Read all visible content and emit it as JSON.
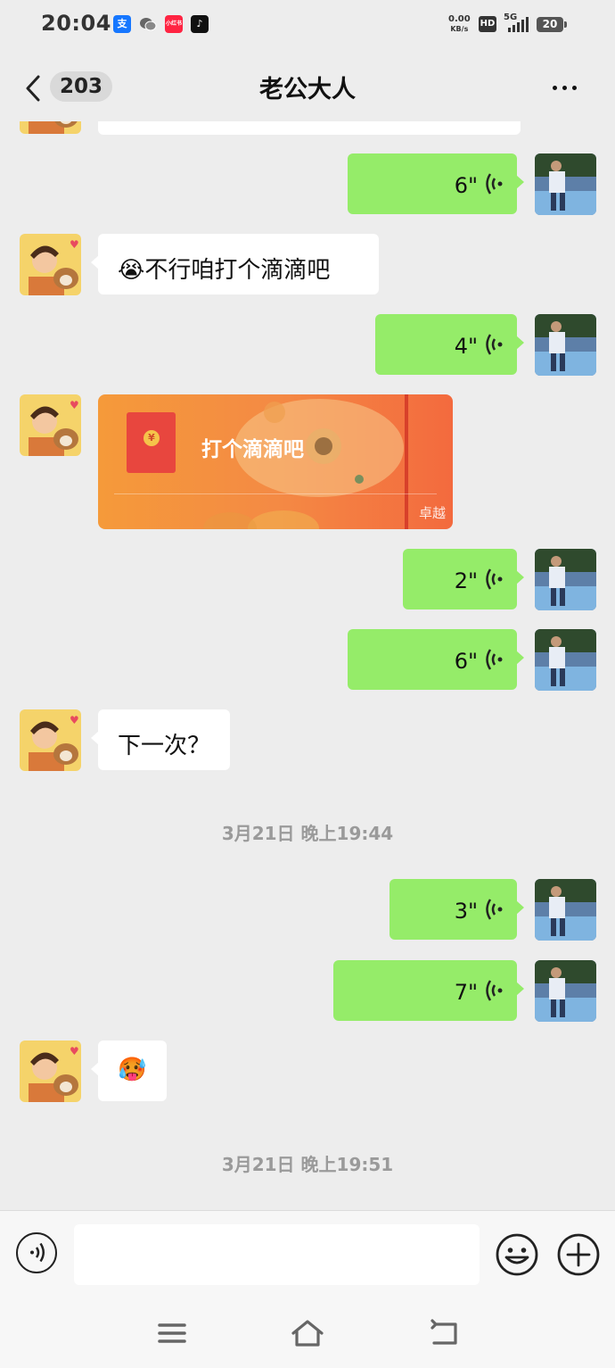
{
  "status_bar": {
    "time": "20:04",
    "apps": [
      {
        "name": "alipay-icon",
        "glyph": "支",
        "color": "#1677ff"
      },
      {
        "name": "wechat-icon",
        "glyph": "●",
        "color": "#666666"
      },
      {
        "name": "xiaohongshu-icon",
        "glyph": "小红书",
        "color": "#ff2442"
      },
      {
        "name": "tiktok-icon",
        "glyph": "♪",
        "color": "#111111"
      }
    ],
    "net_speed_value": "0.00",
    "net_speed_unit": "KB/s",
    "hd": "HD",
    "signal": "5G",
    "battery": "20"
  },
  "header": {
    "unread_count": "203",
    "title": "老公大人"
  },
  "messages": [
    {
      "kind": "voice",
      "side": "right",
      "duration": "6\""
    },
    {
      "kind": "text",
      "side": "left",
      "text": "😭不行咱打个滴滴吧"
    },
    {
      "kind": "voice",
      "side": "right",
      "duration": "4\""
    },
    {
      "kind": "red_packet",
      "side": "left",
      "text": "打个滴滴吧",
      "brand": "卓越",
      "coin": "¥"
    },
    {
      "kind": "voice",
      "side": "right",
      "duration": "2\""
    },
    {
      "kind": "voice",
      "side": "right",
      "duration": "6\""
    },
    {
      "kind": "text",
      "side": "left",
      "text": "下一次？"
    },
    {
      "kind": "timestamp",
      "text": "3月21日 晚上19:44"
    },
    {
      "kind": "voice",
      "side": "right",
      "duration": "3\""
    },
    {
      "kind": "voice",
      "side": "right",
      "duration": "7\""
    },
    {
      "kind": "sticker",
      "side": "left",
      "emoji": "🥵"
    },
    {
      "kind": "timestamp",
      "text": "3月21日 晚上19:51"
    }
  ],
  "input_bar": {
    "value": "",
    "placeholder": ""
  },
  "colors": {
    "chat_bg": "#ededed",
    "my_bubble": "#95ec69",
    "their_bubble": "#ffffff",
    "red_packet": "#f48a44"
  }
}
